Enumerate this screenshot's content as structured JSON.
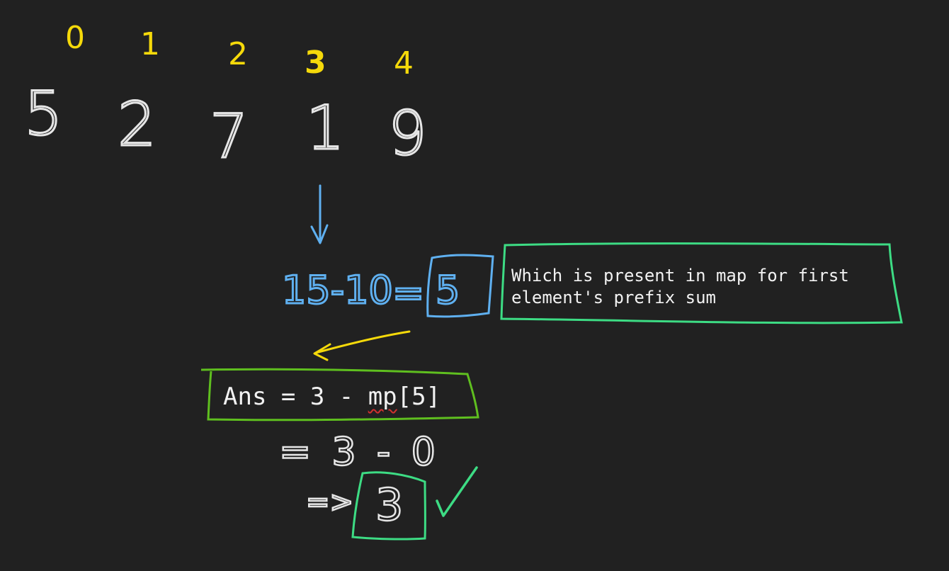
{
  "indices": [
    "0",
    "1",
    "2",
    "3",
    "4"
  ],
  "array_values": [
    "5",
    "2",
    "7",
    "1",
    "9"
  ],
  "equation": {
    "lhs": "15-10",
    "equals": "=",
    "result": "5"
  },
  "note_text": "Which is present in map for first element's prefix sum",
  "formula": {
    "prefix": "Ans = 3 - ",
    "mp_word": "mp",
    "suffix": "[5]"
  },
  "step2": "= 3 - 0",
  "step3": {
    "arrow": "=>",
    "answer": "3",
    "check": "✓"
  },
  "colors": {
    "background": "#212121",
    "index_yellow": "#f5d90a",
    "handwriting": "#e6e6e6",
    "blue": "#5fb0f0",
    "yellow_arrow": "#f5d90a",
    "green": "#3ddc84",
    "lime_box": "#5fbf1f"
  }
}
